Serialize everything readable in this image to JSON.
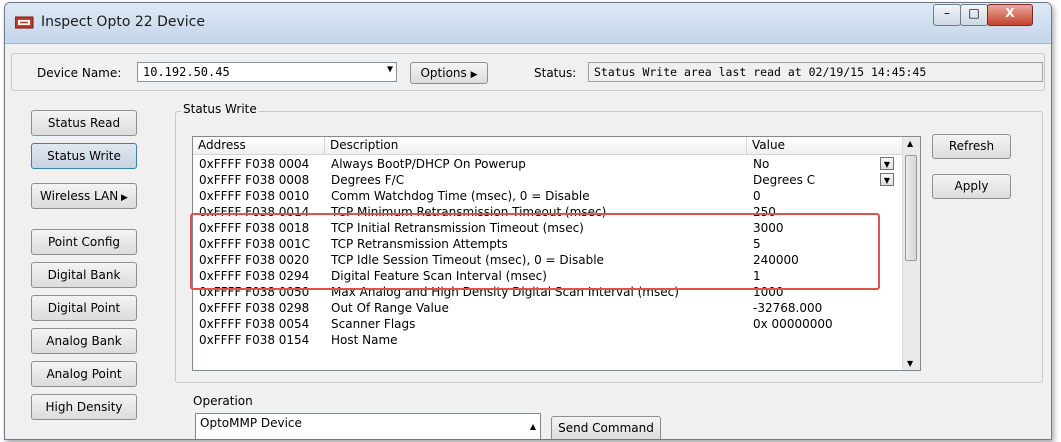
{
  "window": {
    "title": "Inspect Opto 22 Device",
    "close_glyph": "X",
    "minimize_glyph": "–",
    "maximize_glyph": "□"
  },
  "device": {
    "name_label": "Device Name:",
    "name_value": "10.192.50.45",
    "options_label": "Options",
    "status_label": "Status:",
    "status_value": "Status Write area last read at 02/19/15 14:45:45"
  },
  "left_buttons": [
    {
      "label": "Status Read"
    },
    {
      "label": "Status Write"
    },
    {
      "label": "Wireless LAN"
    },
    {
      "label": "Point Config"
    },
    {
      "label": "Digital Bank"
    },
    {
      "label": "Digital Point"
    },
    {
      "label": "Analog Bank"
    },
    {
      "label": "Analog Point"
    },
    {
      "label": "High Density"
    }
  ],
  "group_title": "Status Write",
  "table": {
    "headers": {
      "address": "Address",
      "description": "Description",
      "value": "Value"
    },
    "rows": [
      {
        "address": "0xFFFF F038 0004",
        "description": "Always BootP/DHCP On Powerup",
        "value": "No",
        "dropdown": true
      },
      {
        "address": "0xFFFF F038 0008",
        "description": "Degrees F/C",
        "value": "Degrees C",
        "dropdown": true
      },
      {
        "address": "0xFFFF F038 0010",
        "description": "Comm Watchdog Time (msec), 0 = Disable",
        "value": "0"
      },
      {
        "address": "0xFFFF F038 0014",
        "description": "TCP Minimum Retransmission Timeout (msec)",
        "value": "250"
      },
      {
        "address": "0xFFFF F038 0018",
        "description": "TCP Initial Retransmission Timeout (msec)",
        "value": "3000"
      },
      {
        "address": "0xFFFF F038 001C",
        "description": "TCP Retransmission Attempts",
        "value": "5"
      },
      {
        "address": "0xFFFF F038 0020",
        "description": "TCP Idle Session Timeout (msec), 0 = Disable",
        "value": "240000"
      },
      {
        "address": "0xFFFF F038 0294",
        "description": "Digital Feature Scan Interval (msec)",
        "value": "1"
      },
      {
        "address": "0xFFFF F038 0050",
        "description": "Max Analog and High Density Digital Scan Interval (msec)",
        "value": "1000"
      },
      {
        "address": "0xFFFF F038 0298",
        "description": "Out Of Range Value",
        "value": "-32768.000"
      },
      {
        "address": "0xFFFF F038 0054",
        "description": "Scanner Flags",
        "value": "0x 00000000"
      },
      {
        "address": "0xFFFF F038 0154",
        "description": "Host Name",
        "value": ""
      }
    ]
  },
  "actions": {
    "refresh": "Refresh",
    "apply": "Apply"
  },
  "operation": {
    "label": "Operation",
    "value": "OptoMMP Device",
    "send_label": "Send Command"
  },
  "colors": {
    "highlight": "#e05252",
    "titlebar": "#c3d6ea",
    "face": "#f0f0f0"
  },
  "icons": [
    "app-icon",
    "dropdown-arrow-icon",
    "chevron-right-icon",
    "scroll-up-icon",
    "scroll-down-icon",
    "minimize-icon",
    "maximize-icon",
    "close-icon"
  ]
}
